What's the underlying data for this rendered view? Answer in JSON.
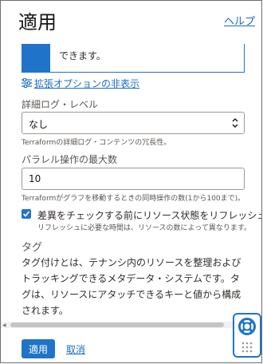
{
  "header": {
    "title": "適用",
    "help_link": "ヘルプ"
  },
  "info_box": {
    "text": "できます。"
  },
  "advanced_toggle": {
    "label": "拡張オプションの非表示"
  },
  "log_level": {
    "label": "詳細ログ・レベル",
    "value": "なし",
    "help": "Terraformの詳細ログ・コンテンツの冗長性。"
  },
  "parallelism": {
    "label": "パラレル操作の最大数",
    "value": "10",
    "help": "Terraformがグラフを移動するときの同時操作の数(1から100まで)。"
  },
  "refresh": {
    "label": "差異をチェックする前にリソース状態をリフレッシュ",
    "help": "リフレッシュに必要な時間は、リソースの数によって異なります。",
    "checked": true
  },
  "tags": {
    "title": "タグ",
    "description": "タグ付けとは、テナンシ内のリソースを整理およびトラッキングできるメタデータ・システムです。タグは、リソースにアタッチできるキーと値から構成されます。"
  },
  "footer": {
    "apply_label": "適用",
    "cancel_label": "取消"
  },
  "colors": {
    "accent": "#1f74c9",
    "link": "#1a6cc4",
    "text": "#312d2a"
  }
}
